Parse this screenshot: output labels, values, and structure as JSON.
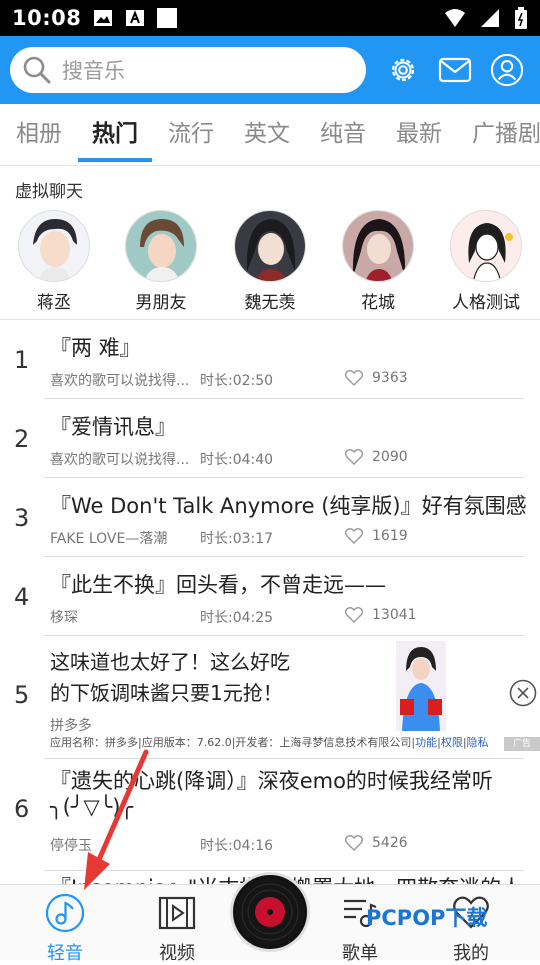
{
  "status": {
    "time": "10:08"
  },
  "search": {
    "placeholder": "搜音乐"
  },
  "tabs": [
    "相册",
    "热门",
    "流行",
    "英文",
    "纯音",
    "最新",
    "广播剧"
  ],
  "active_tab": "热门",
  "section": {
    "title": "虚拟聊天"
  },
  "characters": [
    {
      "name": "蒋丞"
    },
    {
      "name": "男朋友"
    },
    {
      "name": "魏无羡"
    },
    {
      "name": "花城"
    },
    {
      "name": "人格测试"
    }
  ],
  "songs": [
    {
      "num": "1",
      "title": "『两 难』",
      "artist": "喜欢的歌可以说找得...",
      "duration": "时长:02:50",
      "likes": "9363"
    },
    {
      "num": "2",
      "title": "『爱情讯息』",
      "artist": "喜欢的歌可以说找得...",
      "duration": "时长:04:40",
      "likes": "2090"
    },
    {
      "num": "3",
      "title": "『We Don't Talk Anymore (纯享版)』好有氛围感",
      "artist": "FAKE LOVE—落潮",
      "duration": "时长:03:17",
      "likes": "1619"
    },
    {
      "num": "4",
      "title": "『此生不换』回头看，不曾走远——",
      "artist": "栘琛",
      "duration": "时长:04:25",
      "likes": "13041"
    },
    {
      "num": "6",
      "title": "『遗失的心跳(降调）』深夜emo的时候我经常听",
      "title2": "╮(╯▽╰)╭",
      "artist": "停停玉",
      "duration": "时长:04:16",
      "likes": "5426"
    },
    {
      "num": "7",
      "title": "『Insomnia』\"当末指尖\"搬置大地，四散奔逃的人"
    }
  ],
  "ad": {
    "num": "5",
    "line1": "这味道也太好了！这么好吃",
    "line2": "的下饭调味酱只要1元抢！",
    "brand": "拼多多",
    "meta": "应用名称：拼多多|应用版本：7.62.0|开发者：上海寻梦信息技术有限公司|",
    "links": [
      "功能",
      "权限",
      "隐私"
    ],
    "tag": "广告"
  },
  "nav": {
    "items": [
      {
        "label": "轻音",
        "icon": "music-note-icon"
      },
      {
        "label": "视频",
        "icon": "film-icon"
      },
      {
        "label": "歌单",
        "icon": "playlist-icon"
      },
      {
        "label": "我的",
        "icon": "heart-icon"
      }
    ]
  },
  "watermark": "PCPOP下载",
  "colors": {
    "accent": "#2196f3",
    "disc": "#c8102e"
  }
}
